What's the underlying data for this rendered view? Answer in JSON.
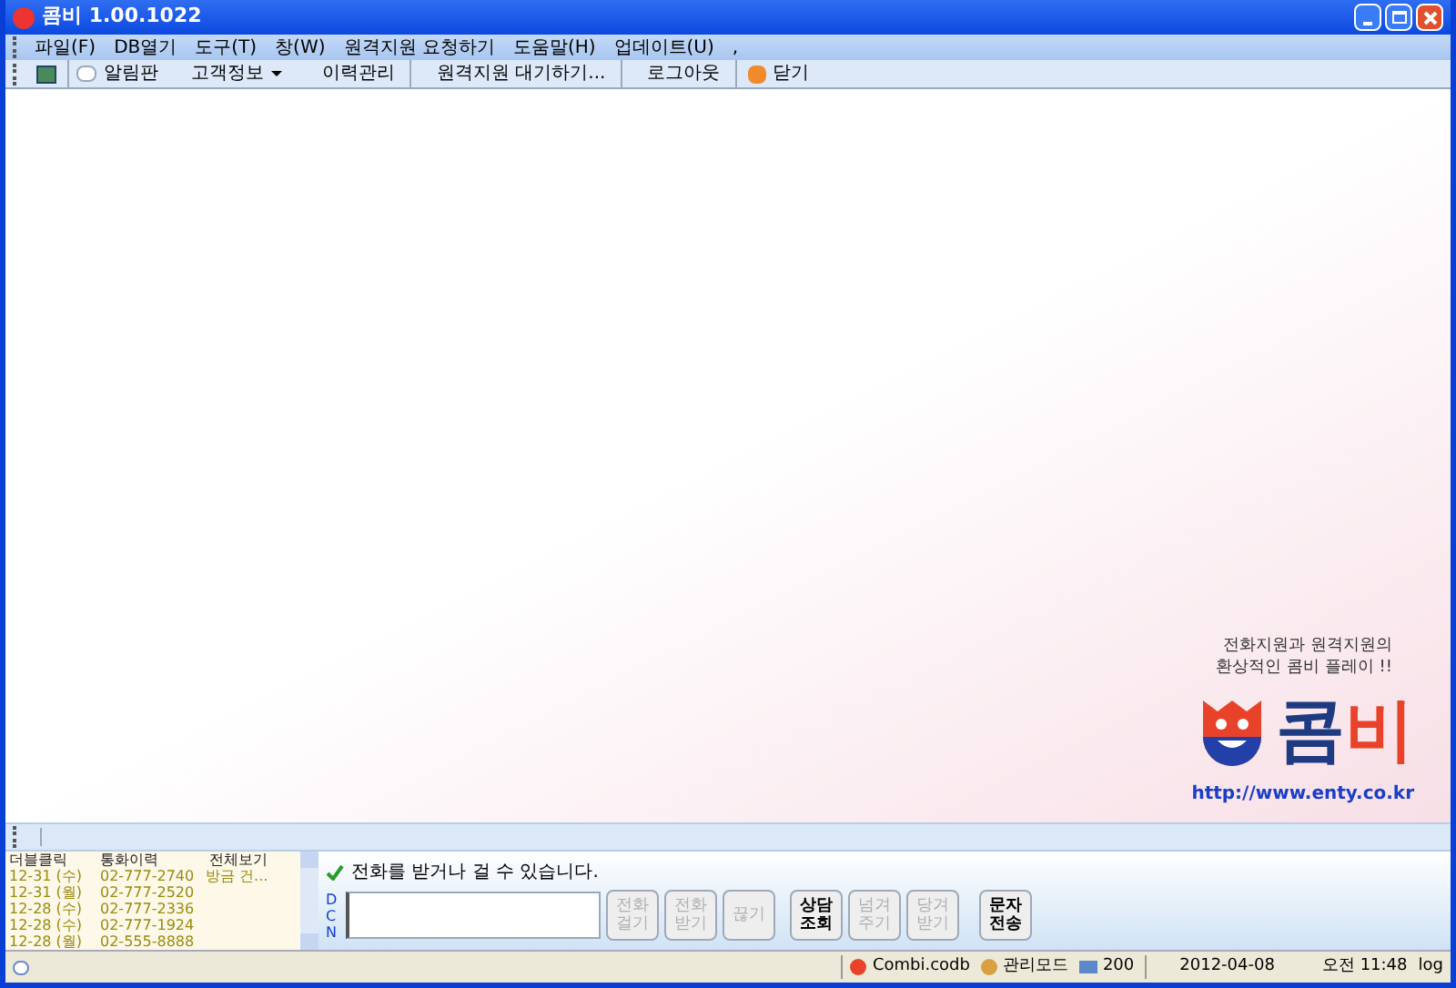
{
  "window": {
    "title": "콤비 1.00.1022"
  },
  "menu": [
    "파일(F)",
    "DB열기",
    "도구(T)",
    "창(W)",
    "원격지원 요청하기",
    "도움말(H)",
    "업데이트(U)",
    ","
  ],
  "toolbar": [
    {
      "kind": "icon"
    },
    {
      "kind": "icon-text",
      "label": "알림판"
    },
    {
      "kind": "dropdown",
      "label": "고객정보"
    },
    {
      "kind": "text",
      "label": "이력관리"
    },
    {
      "kind": "text",
      "label": "원격지원 대기하기..."
    },
    {
      "kind": "text",
      "label": "로그아웃"
    },
    {
      "kind": "close",
      "label": "닫기"
    }
  ],
  "promo": {
    "tagline": [
      "전화지원과 원격지원의",
      "환상적인 콤비 플레이 !!"
    ],
    "logo": [
      "콤",
      "비"
    ],
    "url": "http://www.enty.co.kr"
  },
  "call_history": {
    "columns": [
      "더블클릭",
      "통화이력",
      "전체보기"
    ],
    "rows": [
      {
        "date": "12-31 (수)",
        "number": "02-777-2740",
        "note": "방금 건..."
      },
      {
        "date": "12-31 (월)",
        "number": "02-777-2520"
      },
      {
        "date": "12-28 (수)",
        "number": "02-777-2336"
      },
      {
        "date": "12-28 (수)",
        "number": "02-777-1924"
      },
      {
        "date": "12-28 (월)",
        "number": "02-555-8888"
      }
    ]
  },
  "phone": {
    "status": "전화를 받거나 걸 수 있습니다.",
    "dcn": [
      "D",
      "C",
      "N"
    ],
    "buttons": [
      {
        "label": [
          "전화",
          "걸기"
        ],
        "disabled": true
      },
      {
        "label": [
          "전화",
          "받기"
        ],
        "disabled": true
      },
      {
        "label": [
          "끊기"
        ],
        "disabled": true
      },
      {
        "label": [
          "상담",
          "조회"
        ],
        "disabled": false
      },
      {
        "label": [
          "넘겨",
          "주기"
        ],
        "disabled": true
      },
      {
        "label": [
          "당겨",
          "받기"
        ],
        "disabled": true
      },
      {
        "label": [
          "문자",
          "전송"
        ],
        "disabled": false
      }
    ]
  },
  "status_bar": {
    "db": "Combi.codb",
    "mode": "관리모드",
    "count": "200",
    "date": "2012-04-08",
    "time": "오전 11:48",
    "log": "log"
  }
}
